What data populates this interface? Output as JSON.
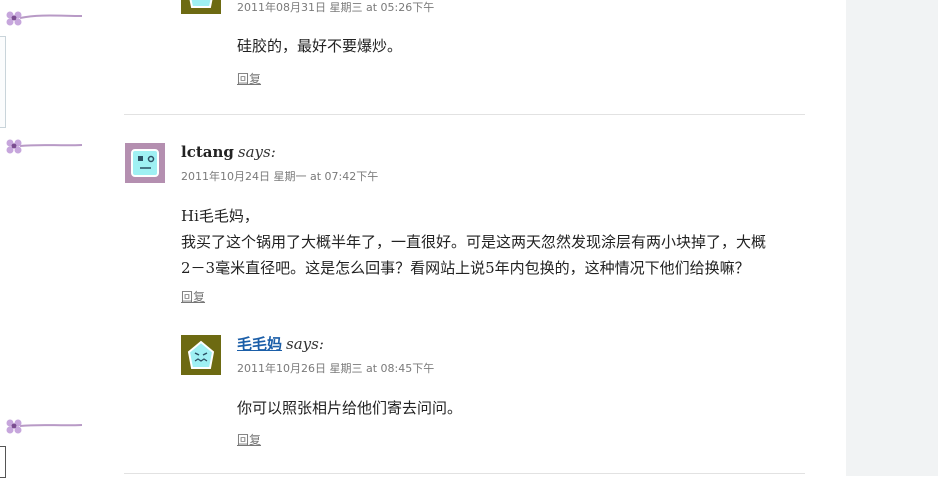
{
  "left_fragment": {
    "link_text": ""
  },
  "comments": [
    {
      "id": "c1",
      "author": "",
      "says": "",
      "date": "2011年08月31日 星期三 at 05:26下午",
      "body": "硅胶的，最好不要爆炒。",
      "reply_label": "回复"
    },
    {
      "id": "c2",
      "author": "lctang",
      "says": "says:",
      "date": "2011年10月24日 星期一 at 07:42下午",
      "body": "Hi毛毛妈，\n我买了这个锅用了大概半年了，一直很好。可是这两天忽然发现涂层有两小块掉了，大概\n2－3毫米直径吧。这是怎么回事？看网站上说5年内包换的，这种情况下他们给换嘛？",
      "reply_label": "回复"
    },
    {
      "id": "c3",
      "author": "毛毛妈",
      "says": "says:",
      "date": "2011年10月26日 星期三 at 08:45下午",
      "body": "你可以照张相片给他们寄去问问。",
      "reply_label": "回复"
    }
  ],
  "colors": {
    "author_link": "#1b5ea8",
    "meta_text": "#7a7a7a",
    "avatar_olive": "#6d6a12",
    "avatar_purple": "#b48fb0",
    "avatar_face": "#9ff0f3"
  },
  "icons": [
    "flower-ornament-icon",
    "pentagon-monster-avatar-icon",
    "square-monster-avatar-icon"
  ]
}
